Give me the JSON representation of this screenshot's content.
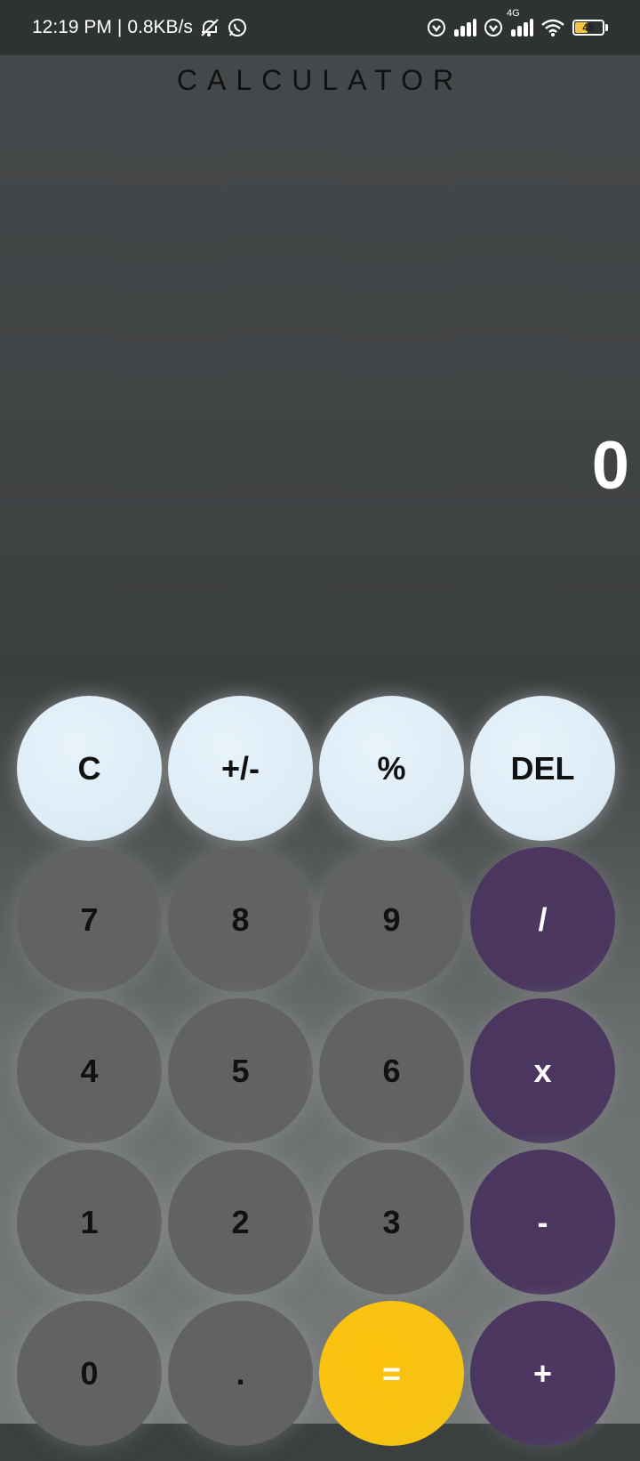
{
  "status_bar": {
    "time": "12:19 PM",
    "separator": "|",
    "net_speed": "0.8KB/s",
    "battery_level": "45",
    "icons": [
      "mute-icon",
      "whatsapp-icon",
      "vpn-icon",
      "signal-icon",
      "vpn-icon",
      "4g-signal-icon",
      "wifi-icon",
      "battery-icon"
    ],
    "network_label": "4G"
  },
  "app": {
    "title": "CALCULATOR",
    "display_value": "0"
  },
  "keypad": {
    "row1": [
      "C",
      "+/-",
      "%",
      "DEL"
    ],
    "row2": [
      "7",
      "8",
      "9",
      "/"
    ],
    "row3": [
      "4",
      "5",
      "6",
      "x"
    ],
    "row4": [
      "1",
      "2",
      "3",
      "-"
    ],
    "row5": [
      "0",
      ".",
      "=",
      "+"
    ]
  },
  "colors": {
    "function_key": "#e3f0f9",
    "number_key": "#616263",
    "operator_key": "#4b3660",
    "equals_key": "#fbc20f",
    "display_text": "#ffffff"
  }
}
